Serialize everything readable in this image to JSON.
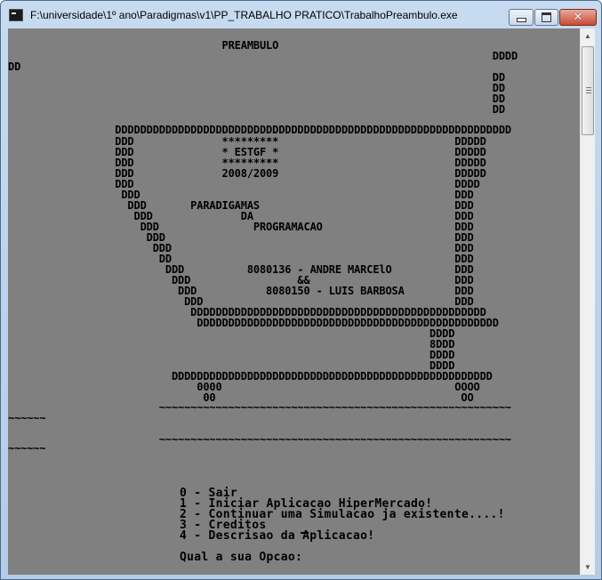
{
  "window": {
    "title": "F:\\universidade\\1º ano\\Paradigmas\\v1\\PP_TRABALHO PRATICO\\TrabalhoPreambulo.exe",
    "buttons": {
      "minimize": "minimize",
      "maximize": "maximize",
      "close": "close"
    }
  },
  "console": {
    "art_lines": [
      "                                  PREAMBULO",
      "                                                                             DDDD",
      "DD",
      "                                                                             DD",
      "                                                                             DD",
      "                                                                             DD",
      "                                                                             DD",
      "                 DDDDDDDDDDDDDDDDDDDDDDDDDDDDDDDDDDDDDDDDDDDDDDDDDDDDDDDDDDDDDDD",
      "                 DDD              *********                            DDDDD",
      "                 DDD              * ESTGF *                            DDDDD",
      "                 DDD              *********                            DDDDD",
      "                 DDD              2008/2009                            DDDDD",
      "                 DDD                                                   DDDD",
      "                  DDD                                                  DDD",
      "                   DDD       PARADIGAMAS                               DDD",
      "                    DDD              DA                                DDD",
      "                     DDD               PROGRAMACAO                     DDD",
      "                      DDD                                              DDD",
      "                       DDD                                             DDD",
      "                        DD                                             DDD",
      "                         DDD          8080136 - ANDRE MARCElO          DDD",
      "                          DDD                 &&                       DDD",
      "                           DDD           8080150 - LUIS BARBOSA        DDD",
      "                            DDD                                        DDD",
      "                             DDDDDDDDDDDDDDDDDDDDDDDDDDDDDDDDDDDDDDDDDDDDDDD",
      "                              DDDDDDDDDDDDDDDDDDDDDDDDDDDDDDDDDDDDDDDDDDDDDDDD",
      "                                                                   DDDD",
      "                                                                   8DDD",
      "                                                                   DDDD",
      "                                                                   DDDD",
      "                          DDDDDDDDDDDDDDDDDDDDDDDDDDDDDDDDDDDDDDDDDDDDDDDDDDD",
      "                              0000                                     OOOO",
      "                               00                                       OO",
      "                        ~~~~~~~~~~~~~~~~~~~~~~~~~~~~~~~~~~~~~~~~~~~~~~~~~~~~~~~~",
      "~~~~~~",
      "",
      "                        ~~~~~~~~~~~~~~~~~~~~~~~~~~~~~~~~~~~~~~~~~~~~~~~~~~~~~~~~",
      "~~~~~~"
    ],
    "menu": [
      "0 - Sair",
      "1 - Iniciar Aplicacao HiperMercado!",
      "2 - Continuar uma Simulacao ja existente....!",
      "3 - Creditos",
      "4 - Descrisao da Aplicacao!"
    ],
    "prompt": "Qual a sua Opcao:"
  }
}
